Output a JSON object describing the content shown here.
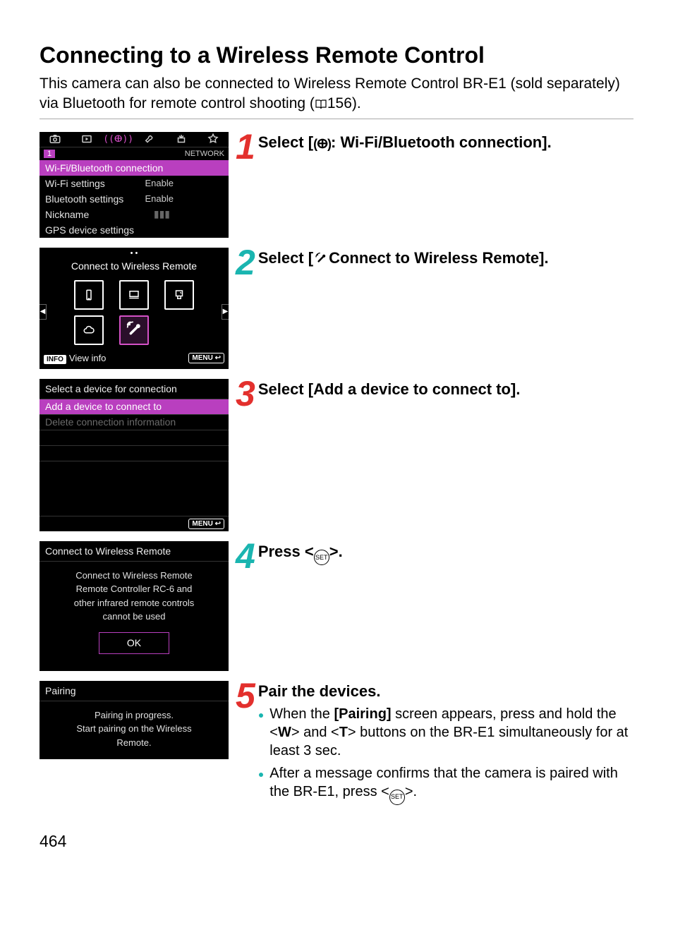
{
  "page": {
    "title": "Connecting to a Wireless Remote Control",
    "intro_pre": "This camera can also be connected to Wireless Remote Control BR-E1 (sold separately) via Bluetooth for remote control shooting (",
    "intro_ref": "156).",
    "number": "464"
  },
  "steps": {
    "s1": {
      "num": "1",
      "pre": "Select [",
      "post": ": Wi-Fi/Bluetooth connection]."
    },
    "s2": {
      "num": "2",
      "pre": "Select [",
      "post": "Connect to Wireless Remote]."
    },
    "s3": {
      "num": "3",
      "text": "Select [Add a device to connect to]."
    },
    "s4": {
      "num": "4",
      "pre": "Press <",
      "post": ">."
    },
    "s5": {
      "num": "5",
      "head": "Pair the devices.",
      "b1_pre": "When the ",
      "b1_bold": "[Pairing]",
      "b1_mid": " screen appears, press and hold the <",
      "b1_w": "W",
      "b1_mid2": "> and <",
      "b1_t": "T",
      "b1_post": "> buttons on the BR-E1 simultaneously for at least 3 sec.",
      "b2_pre": "After a message confirms that the camera is paired with the BR-E1, press <",
      "b2_post": ">."
    }
  },
  "panel1": {
    "num": "1",
    "network": "NETWORK",
    "rows": {
      "r1": "Wi-Fi/Bluetooth connection",
      "r2": "Wi-Fi settings",
      "r2v": "Enable",
      "r3": "Bluetooth settings",
      "r3v": "Enable",
      "r4": "Nickname",
      "r5": "GPS device settings"
    }
  },
  "panel2": {
    "title": "Connect to Wireless Remote",
    "info": "INFO",
    "view": "View info",
    "menu": "MENU"
  },
  "panel3": {
    "head": "Select a device for connection",
    "r1": "Add a device to connect to",
    "r2": "Delete connection information",
    "menu": "MENU"
  },
  "panel4": {
    "head": "Connect to Wireless Remote",
    "l1": "Connect to Wireless Remote",
    "l2": "Remote Controller RC-6 and",
    "l3": "other infrared remote controls",
    "l4": "cannot be used",
    "ok": "OK"
  },
  "panel5": {
    "head": "Pairing",
    "l1": "Pairing in progress.",
    "l2": "Start pairing on the Wireless",
    "l3": "Remote."
  },
  "set_label": "SET"
}
